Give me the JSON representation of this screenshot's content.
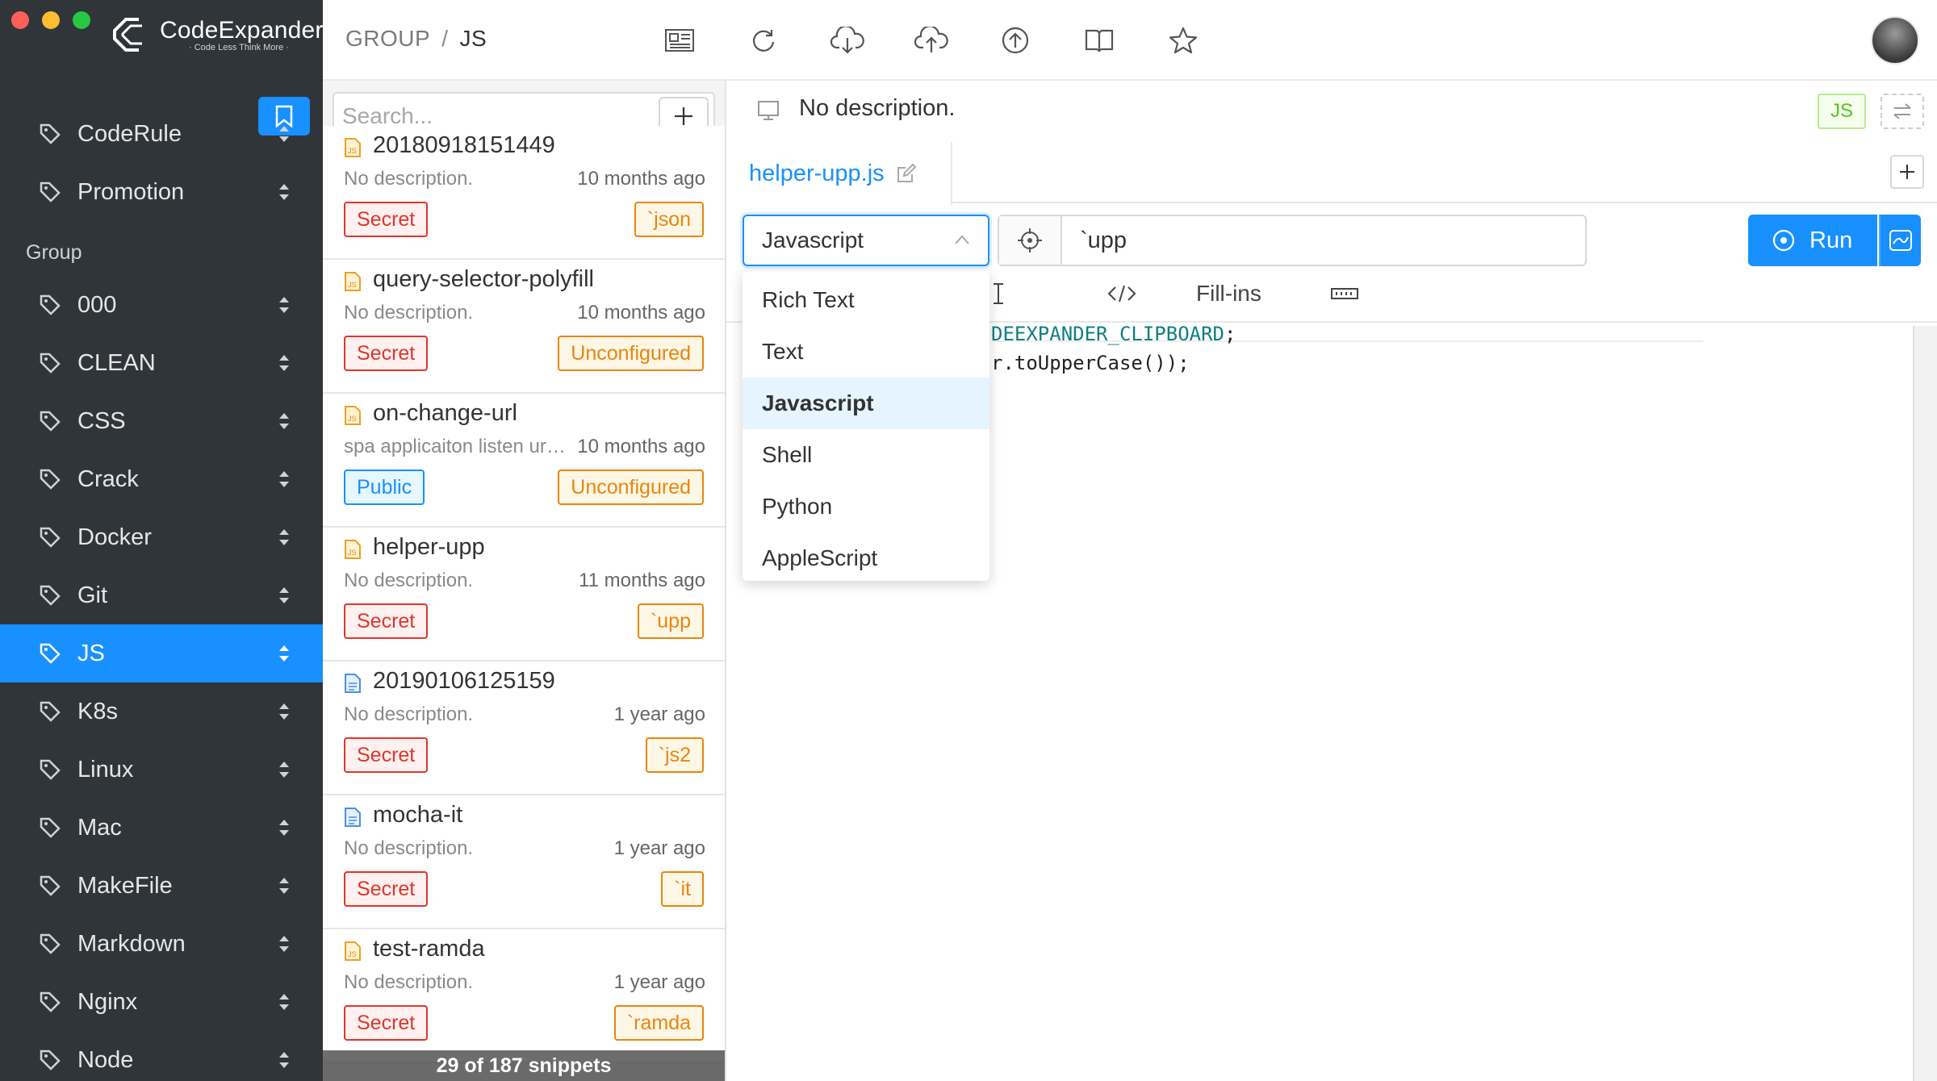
{
  "app": {
    "brand_name": "CodeExpander",
    "brand_tagline": "· Code Less Think More ·"
  },
  "sidebar": {
    "top_items": [
      {
        "label": "CodeRule"
      },
      {
        "label": "Promotion"
      }
    ],
    "section_label": "Group",
    "groups": [
      {
        "label": "000"
      },
      {
        "label": "CLEAN"
      },
      {
        "label": "CSS"
      },
      {
        "label": "Crack"
      },
      {
        "label": "Docker"
      },
      {
        "label": "Git"
      },
      {
        "label": "JS",
        "active": true
      },
      {
        "label": "K8s"
      },
      {
        "label": "Linux"
      },
      {
        "label": "Mac"
      },
      {
        "label": "MakeFile"
      },
      {
        "label": "Markdown"
      },
      {
        "label": "Nginx"
      },
      {
        "label": "Node"
      }
    ]
  },
  "header": {
    "breadcrumb_root": "GROUP",
    "breadcrumb_sep": "/",
    "breadcrumb_current": "JS"
  },
  "list": {
    "search_placeholder": "Search...",
    "footer": "29 of 187 snippets",
    "snippets": [
      {
        "title": "20180918151449",
        "desc": "No description.",
        "time": "10 months ago",
        "left_badge": "Secret",
        "right_badge": "`json",
        "icon": "js-file-icon"
      },
      {
        "title": "query-selector-polyfill",
        "desc": "No description.",
        "time": "10 months ago",
        "left_badge": "Secret",
        "right_badge": "Unconfigured",
        "icon": "js-file-icon"
      },
      {
        "title": "on-change-url",
        "desc": "spa applicaiton listen url change",
        "time": "10 months ago",
        "left_badge": "Public",
        "right_badge": "Unconfigured",
        "icon": "js-file-icon"
      },
      {
        "title": "helper-upp",
        "desc": "No description.",
        "time": "11 months ago",
        "left_badge": "Secret",
        "right_badge": "`upp",
        "icon": "js-file-icon"
      },
      {
        "title": "20190106125159",
        "desc": "No description.",
        "time": "1 year ago",
        "left_badge": "Secret",
        "right_badge": "`js2",
        "icon": "doc-file-icon"
      },
      {
        "title": "mocha-it",
        "desc": "No description.",
        "time": "1 year ago",
        "left_badge": "Secret",
        "right_badge": "`it",
        "icon": "doc-file-icon"
      },
      {
        "title": "test-ramda",
        "desc": "No description.",
        "time": "1 year ago",
        "left_badge": "Secret",
        "right_badge": "`ramda",
        "icon": "js-file-icon"
      }
    ]
  },
  "detail": {
    "description": "No description.",
    "lang_tag": "JS",
    "file_tab": "helper-upp.js",
    "language_value": "Javascript",
    "trigger": "`upp",
    "run_label": "Run",
    "fill_ins_label": "Fill-ins",
    "code_lines": [
      {
        "kw": "DEEXPANDER_CLIPBOARD",
        "rest": ";"
      },
      {
        "kw": "",
        "rest": "r.toUpperCase());"
      }
    ],
    "language_options": [
      {
        "label": "Rich Text",
        "selected": false
      },
      {
        "label": "Text",
        "selected": false
      },
      {
        "label": "Javascript",
        "selected": true
      },
      {
        "label": "Shell",
        "selected": false
      },
      {
        "label": "Python",
        "selected": false
      },
      {
        "label": "AppleScript",
        "selected": false
      }
    ]
  },
  "colors": {
    "accent": "#1890ff",
    "sidebar_bg": "#303539",
    "secret": "#e0352b",
    "public": "#1890ff",
    "orange": "#e8860d",
    "js_tag": "#52c41a"
  }
}
